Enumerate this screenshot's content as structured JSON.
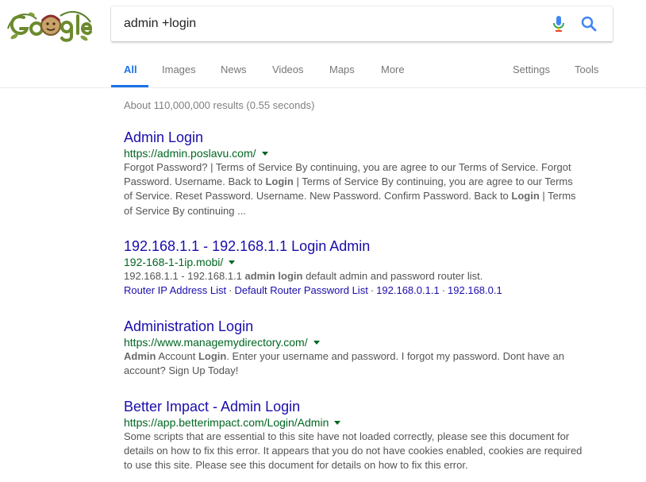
{
  "search": {
    "query": "admin +login"
  },
  "tabs": [
    {
      "label": "All"
    },
    {
      "label": "Images"
    },
    {
      "label": "News"
    },
    {
      "label": "Videos"
    },
    {
      "label": "Maps"
    },
    {
      "label": "More"
    },
    {
      "label": "Settings"
    },
    {
      "label": "Tools"
    }
  ],
  "stats": "About 110,000,000 results (0.55 seconds)",
  "results": [
    {
      "title": "Admin Login",
      "url": "https://admin.poslavu.com/",
      "snippet": [
        {
          "t": "Forgot Password? | Terms of Service By continuing, you are agree to our Terms of Service. Forgot Password. Username. Back to "
        },
        {
          "b": "Login"
        },
        {
          "t": " | Terms of Service By continuing, you are agree to our Terms of Service. Reset Password. Username. New Password. Confirm Password. Back to "
        },
        {
          "b": "Login"
        },
        {
          "t": " | Terms of Service By continuing ..."
        }
      ]
    },
    {
      "title": "192.168.1.1 - 192.168.1.1 Login Admin",
      "url": "192-168-1-1ip.mobi/",
      "snippet": [
        {
          "t": "192.168.1.1 - 192.168.1.1 "
        },
        {
          "b": "admin login"
        },
        {
          "t": " default admin and password router list."
        }
      ],
      "sitelinks": [
        "Router IP Address List",
        "Default Router Password List",
        "192.168.0.1.1",
        "192.168.0.1"
      ]
    },
    {
      "title": "Administration Login",
      "url": "https://www.managemydirectory.com/",
      "snippet": [
        {
          "b": "Admin"
        },
        {
          "t": " Account "
        },
        {
          "b": "Login"
        },
        {
          "t": ". Enter your username and password. I forgot my password. Dont have an account? Sign Up Today!"
        }
      ]
    },
    {
      "title": "Better Impact - Admin Login",
      "url": "https://app.betterimpact.com/Login/Admin",
      "snippet": [
        {
          "t": "Some scripts that are essential to this site have not loaded correctly, please see this document for details on how to fix this error. It appears that you do not have cookies enabled, cookies are required to use this site. Please see this document for details on how to fix this error."
        }
      ]
    }
  ],
  "colors": {
    "title": "#1a0dab",
    "url": "#006621",
    "snippet": "#545454",
    "active_tab": "#1a73e8"
  },
  "icons": {
    "logo": "google-doodle-logo",
    "mic": "microphone-icon",
    "search": "magnifier-icon",
    "result_menu": "caret-down-icon"
  }
}
